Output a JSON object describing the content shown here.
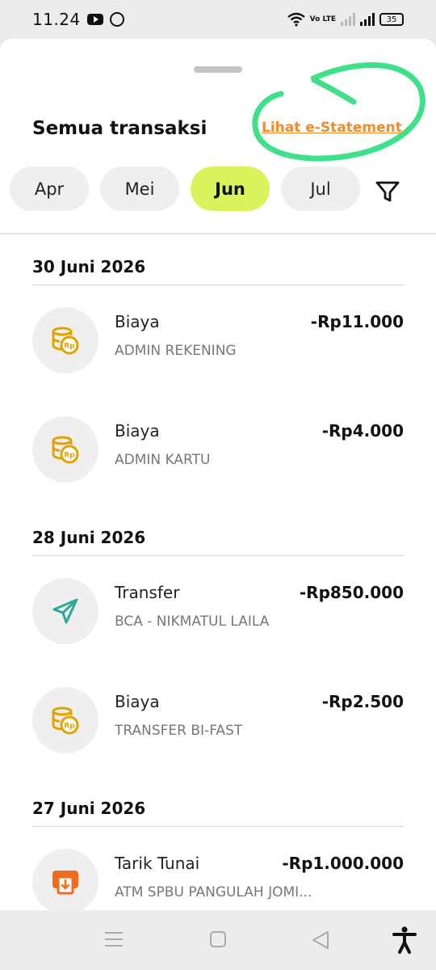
{
  "status_bar": {
    "time": "11.24",
    "battery": "35",
    "volte": "Vo LTE"
  },
  "header": {
    "title": "Semua transaksi",
    "estatement_link": "Lihat e-Statement",
    "annotation_color": "#3ee08a"
  },
  "months": [
    {
      "label": "Apr",
      "active": false
    },
    {
      "label": "Mei",
      "active": false
    },
    {
      "label": "Jun",
      "active": true
    },
    {
      "label": "Jul",
      "active": false
    }
  ],
  "groups": [
    {
      "date": "30 Juni 2026",
      "transactions": [
        {
          "icon": "coins-rp-icon",
          "type": "Biaya",
          "desc": "ADMIN REKENING",
          "amount": "-Rp11.000"
        },
        {
          "icon": "coins-rp-icon",
          "type": "Biaya",
          "desc": "ADMIN KARTU",
          "amount": "-Rp4.000"
        }
      ]
    },
    {
      "date": "28 Juni 2026",
      "transactions": [
        {
          "icon": "send-icon",
          "type": "Transfer",
          "desc": "BCA - NIKMATUL LAILA",
          "amount": "-Rp850.000"
        },
        {
          "icon": "coins-rp-icon",
          "type": "Biaya",
          "desc": "TRANSFER BI-FAST",
          "amount": "-Rp2.500"
        }
      ]
    },
    {
      "date": "27 Juni 2026",
      "transactions": [
        {
          "icon": "atm-withdraw-icon",
          "type": "Tarik Tunai",
          "desc": "ATM SPBU PANGULAH JOMI...",
          "amount": "-Rp1.000.000"
        }
      ]
    }
  ],
  "colors": {
    "accent_active": "#dcf25a",
    "link": "#f08a2c",
    "coin": "#e0a400",
    "send": "#2fa89a",
    "atm": "#f26b1d"
  }
}
